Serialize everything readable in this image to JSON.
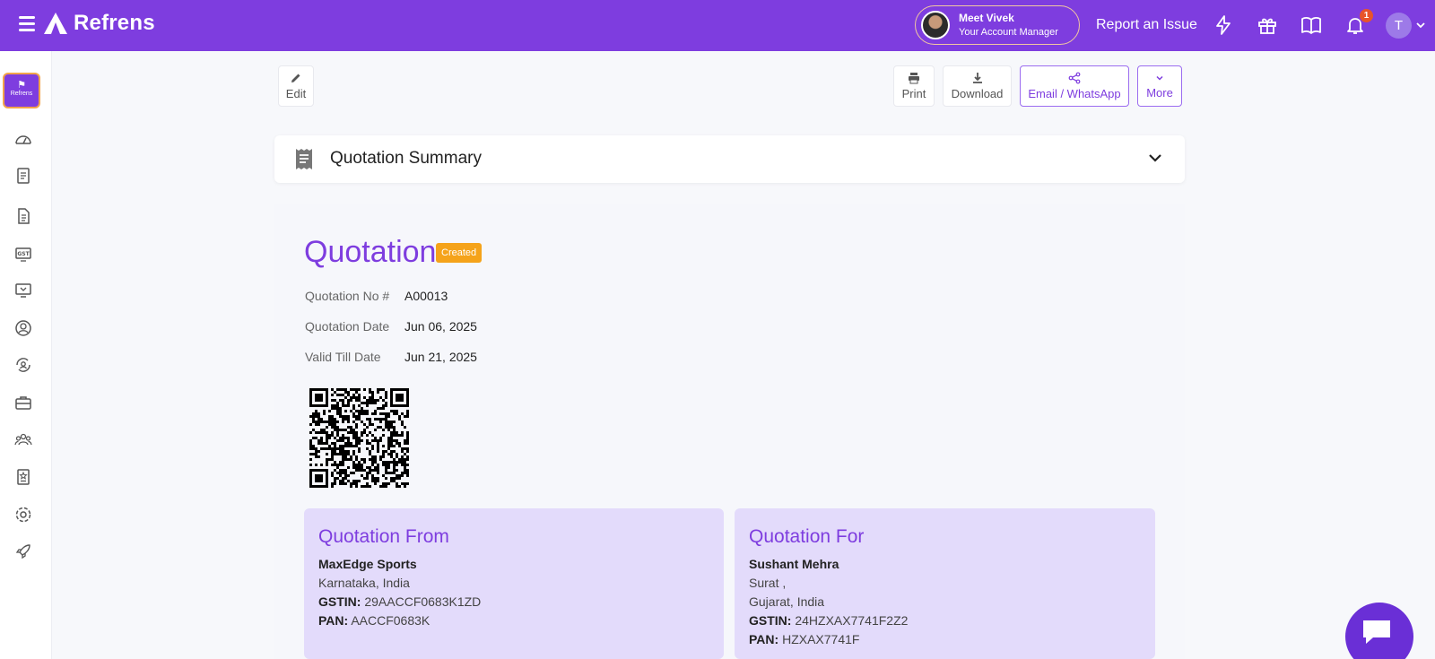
{
  "app": {
    "brand": "Refrens",
    "account_manager": {
      "name": "Meet Vivek",
      "role": "Your Account Manager"
    },
    "report_issue": "Report an Issue",
    "notification_count": "1",
    "user_initial": "T",
    "colors": {
      "brand": "#7e3ddf",
      "badge": "#f5a31a",
      "panel": "#e3dbfb"
    }
  },
  "sidebar": {
    "logo_text": "Refrens",
    "items": [
      "dashboard-icon",
      "invoice-icon",
      "document-icon",
      "gst-icon",
      "monitor-icon",
      "contact-icon",
      "refresh-user-icon",
      "briefcase-icon",
      "team-icon",
      "report-icon",
      "settings-icon",
      "rocket-icon"
    ],
    "gst_label": "GST"
  },
  "toolbar": {
    "edit": "Edit",
    "print": "Print",
    "download": "Download",
    "email_whatsapp": "Email / WhatsApp",
    "more": "More"
  },
  "summary": {
    "title": "Quotation Summary"
  },
  "quotation": {
    "title": "Quotation",
    "status": "Created",
    "fields": [
      {
        "label": "Quotation No #",
        "value": "A00013"
      },
      {
        "label": "Quotation Date",
        "value": "Jun 06, 2025"
      },
      {
        "label": "Valid Till Date",
        "value": "Jun 21, 2025"
      }
    ]
  },
  "from": {
    "title": "Quotation From",
    "name": "MaxEdge Sports",
    "location": "Karnataka, India",
    "gstin_label": "GSTIN:",
    "gstin": "29AACCF0683K1ZD",
    "pan_label": "PAN:",
    "pan": "AACCF0683K"
  },
  "for": {
    "title": "Quotation For",
    "name": "Sushant Mehra",
    "city": "Surat ,",
    "location": "Gujarat, India",
    "gstin_label": "GSTIN:",
    "gstin": "24HZXAX7741F2Z2",
    "pan_label": "PAN:",
    "pan": "HZXAX7741F"
  }
}
